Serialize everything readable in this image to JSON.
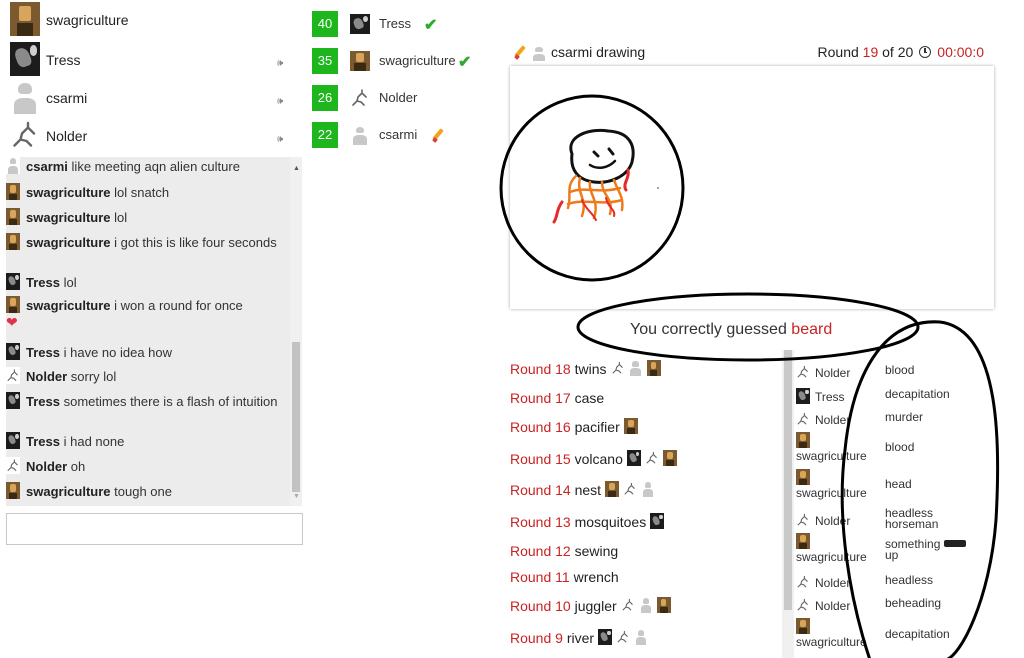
{
  "players": [
    {
      "name": "swagriculture",
      "avatar": "swag",
      "speaker": ""
    },
    {
      "name": "Tress",
      "avatar": "tress",
      "speaker": "speaker-icon"
    },
    {
      "name": "csarmi",
      "avatar": "csarmi",
      "speaker": "speaker-icon"
    },
    {
      "name": "Nolder",
      "avatar": "nolder",
      "speaker": "speaker-icon"
    }
  ],
  "speaker_glyph": "🕪",
  "scores": [
    {
      "score": "40",
      "name": "Tress",
      "avatar": "tress",
      "status": "check"
    },
    {
      "score": "35",
      "name": "swagriculture",
      "avatar": "swag",
      "status": "check"
    },
    {
      "score": "26",
      "name": "Nolder",
      "avatar": "nolder",
      "status": ""
    },
    {
      "score": "22",
      "name": "csarmi",
      "avatar": "csarmi",
      "status": "pencil"
    }
  ],
  "check_glyph": "✔",
  "chat": [
    {
      "user": "csarmi",
      "avatar": "csarmi",
      "text": "like meeting aqn alien culture"
    },
    {
      "user": "swagriculture",
      "avatar": "swag",
      "text": "lol snatch"
    },
    {
      "user": "swagriculture",
      "avatar": "swag",
      "text": "lol"
    },
    {
      "user": "swagriculture",
      "avatar": "swag",
      "text": "i got this is like four seconds"
    },
    {
      "user": "Tress",
      "avatar": "tress",
      "text": "lol"
    },
    {
      "user": "swagriculture",
      "avatar": "swag",
      "text": "i won a round for once"
    },
    {
      "user": "Tress",
      "avatar": "tress",
      "text": "i have no idea how"
    },
    {
      "user": "Nolder",
      "avatar": "nolder",
      "text": "sorry lol"
    },
    {
      "user": "Tress",
      "avatar": "tress",
      "text": "sometimes there is a flash of intuition"
    },
    {
      "user": "Tress",
      "avatar": "tress",
      "text": "i had none"
    },
    {
      "user": "Nolder",
      "avatar": "nolder",
      "text": "oh"
    },
    {
      "user": "swagriculture",
      "avatar": "swag",
      "text": "tough one"
    }
  ],
  "heart_glyph": "❤",
  "chat_input": {
    "value": "",
    "placeholder": ""
  },
  "drawing": {
    "drawer_name": "csarmi",
    "drawing_label": "drawing",
    "round_word": "Round",
    "round_current": "19",
    "round_of": "of 20",
    "timer": "00:00:0"
  },
  "result": {
    "prefix": "You correctly guessed",
    "word": "beard"
  },
  "rounds": [
    {
      "label": "Round 18",
      "word": "twins",
      "avatars": [
        "nolder",
        "csarmi",
        "swag"
      ]
    },
    {
      "label": "Round 17",
      "word": "case",
      "avatars": []
    },
    {
      "label": "Round 16",
      "word": "pacifier",
      "avatars": [
        "swag"
      ]
    },
    {
      "label": "Round 15",
      "word": "volcano",
      "avatars": [
        "tress",
        "nolder",
        "swag"
      ]
    },
    {
      "label": "Round 14",
      "word": "nest",
      "avatars": [
        "swag",
        "nolder",
        "csarmi"
      ]
    },
    {
      "label": "Round 13",
      "word": "mosquitoes",
      "avatars": [
        "tress"
      ]
    },
    {
      "label": "Round 12",
      "word": "sewing",
      "avatars": []
    },
    {
      "label": "Round 11",
      "word": "wrench",
      "avatars": []
    },
    {
      "label": "Round 10",
      "word": "juggler",
      "avatars": [
        "nolder",
        "csarmi",
        "swag"
      ]
    },
    {
      "label": "Round 9",
      "word": "river",
      "avatars": [
        "tress",
        "nolder",
        "csarmi"
      ]
    }
  ],
  "guesses": [
    {
      "name": "Nolder",
      "avatar": "nolder",
      "word": "blood"
    },
    {
      "name": "Tress",
      "avatar": "tress",
      "word": "decapitation"
    },
    {
      "name": "Nolder",
      "avatar": "nolder",
      "word": "murder"
    },
    {
      "name": "swagriculture",
      "avatar": "swag",
      "word": "blood"
    },
    {
      "name": "swagriculture",
      "avatar": "swag",
      "word": "head"
    },
    {
      "name": "Nolder",
      "avatar": "nolder",
      "word": "headless horseman"
    },
    {
      "name": "swagriculture",
      "avatar": "swag",
      "word": "something",
      "censored": true,
      "word_after": "up"
    },
    {
      "name": "Nolder",
      "avatar": "nolder",
      "word": "headless"
    },
    {
      "name": "Nolder",
      "avatar": "nolder",
      "word": "beheading"
    },
    {
      "name": "swagriculture",
      "avatar": "swag",
      "word": "decapitation"
    }
  ],
  "colors": {
    "score_green": "#1db71d",
    "round_red": "#c92323",
    "chat_bg": "#ececec",
    "annotation_ink": "#000000",
    "doodle_orange": "#f07a1a",
    "doodle_red": "#e52a2a"
  }
}
